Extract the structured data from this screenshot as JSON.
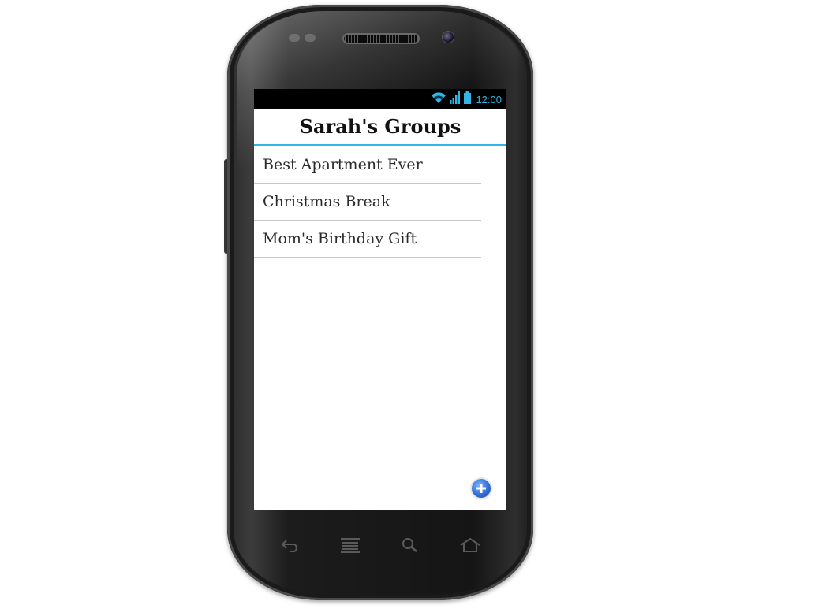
{
  "status_bar": {
    "time": "12:00",
    "accent_color": "#33b5e5"
  },
  "header": {
    "title": "Sarah's Groups"
  },
  "groups": [
    {
      "label": "Best Apartment Ever"
    },
    {
      "label": "Christmas Break"
    },
    {
      "label": "Mom's Birthday Gift"
    }
  ],
  "actions": {
    "add_icon": "plus-circle-icon"
  },
  "nav_bar": {
    "buttons": [
      "back-icon",
      "menu-icon",
      "search-icon",
      "home-icon"
    ]
  }
}
